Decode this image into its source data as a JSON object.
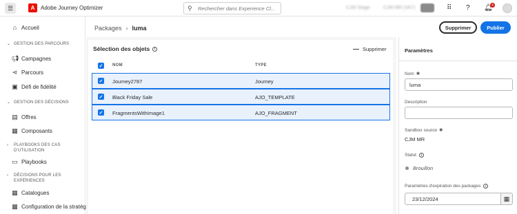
{
  "header": {
    "app_title": "Adobe Journey Optimizer",
    "search_placeholder": "Rechercher dans Experience Cl...",
    "org_name": "CJM Stage",
    "sandbox_name": "CJM MR (VA7)",
    "notification_count": "4"
  },
  "sidebar": {
    "home": "Accueil",
    "sections": [
      {
        "title": "GESTION DES PARCOURS",
        "items": [
          "Campagnes",
          "Parcours",
          "Défi de fidélité"
        ]
      },
      {
        "title": "GESTION DES DÉCISIONS",
        "items": [
          "Offres",
          "Composants"
        ]
      },
      {
        "title_line1": "PLAYBOOKS DES CAS",
        "title_line2": "D'UTILISATION",
        "items": [
          "Playbooks"
        ]
      },
      {
        "title_line1": "DÉCISIONS POUR LES",
        "title_line2": "EXPÉRIENCES",
        "items": [
          "Catalogues",
          "Configuration de la stratégie"
        ]
      }
    ]
  },
  "breadcrumb": {
    "root": "Packages",
    "current": "luma"
  },
  "actions": {
    "delete": "Supprimer",
    "publish": "Publier"
  },
  "selection": {
    "title": "Sélection des objets",
    "delete_label": "Supprimer",
    "columns": {
      "name": "NOM",
      "type": "TYPE"
    },
    "rows": [
      {
        "name": "Journey2787",
        "type": "Journey"
      },
      {
        "name": "Black Friday Sale",
        "type": "AJO_TEMPLATE"
      },
      {
        "name": "FragmentsWithImage1",
        "type": "AJO_FRAGMENT"
      }
    ]
  },
  "panel": {
    "title": "Paramètres",
    "name_label": "Nom",
    "name_value": "luma",
    "description_label": "Description",
    "description_value": "",
    "sandbox_label": "Sandbox source",
    "sandbox_value": "CJM MR",
    "status_label": "Statut",
    "status_value": "Brouillon",
    "expiry_label": "Paramètres d'expiration des packages",
    "expiry_value": "23/12/2024"
  }
}
